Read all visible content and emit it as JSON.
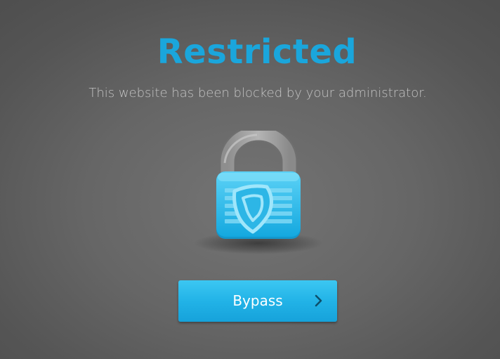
{
  "page": {
    "title": "Restricted",
    "message": "This website has been blocked by your administrator."
  },
  "lock": {
    "icon": "padlock-shield-icon"
  },
  "bypass_button": {
    "label": "Bypass",
    "icon": "chevron-right-icon"
  },
  "colors": {
    "accent": "#1aa6dc",
    "background": "#666666",
    "subtitle": "#c3c3c3",
    "button": "#22b3e7",
    "button_text": "#ffffff",
    "shackle": "#a6a6a6"
  }
}
